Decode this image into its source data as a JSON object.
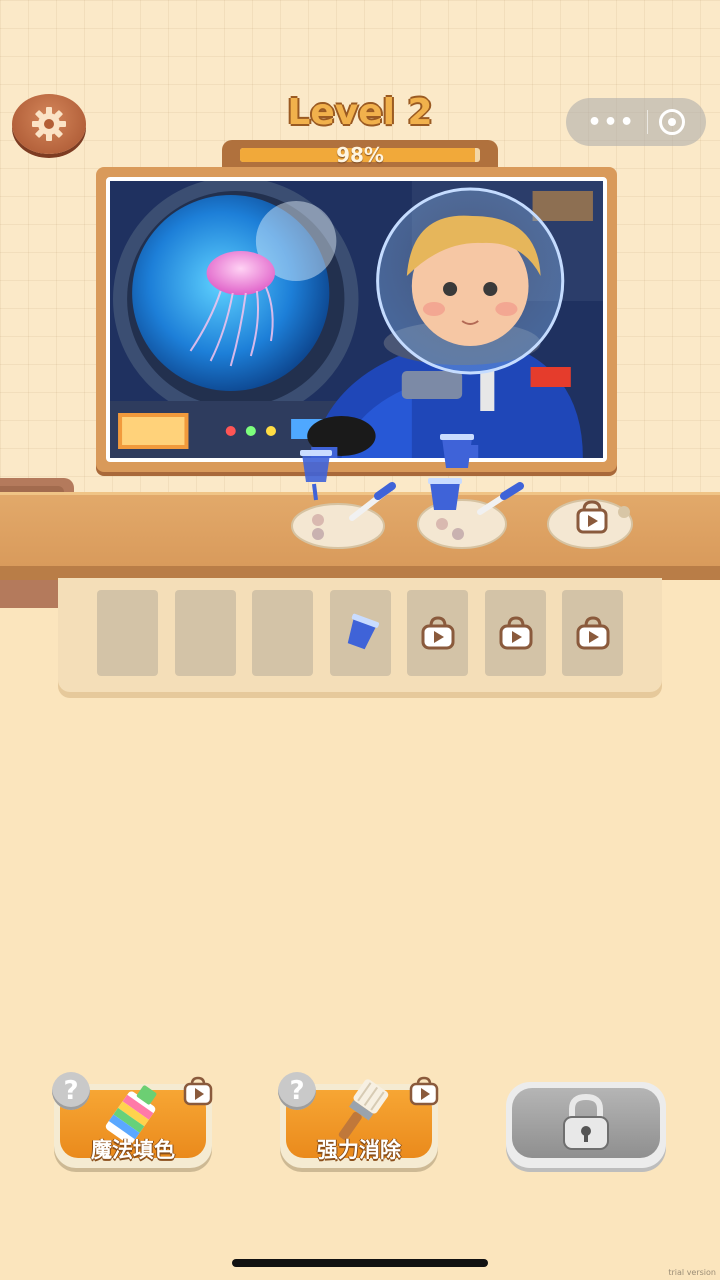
{
  "header": {
    "level_title": "Level 2",
    "progress_text": "98%",
    "progress_fraction": 0.98
  },
  "capsule": {
    "more_icon": "more-dots-icon",
    "close_icon": "target-circle-icon"
  },
  "painting": {
    "subject": "astronaut-boy-jellyfish-porthole"
  },
  "shelf": {
    "palettes": [
      {
        "state": "cup-and-brush"
      },
      {
        "state": "cup-and-brush"
      },
      {
        "state": "locked-video"
      }
    ]
  },
  "slots": [
    {
      "state": "empty"
    },
    {
      "state": "empty"
    },
    {
      "state": "empty"
    },
    {
      "state": "cup"
    },
    {
      "state": "locked-video"
    },
    {
      "state": "locked-video"
    },
    {
      "state": "locked-video"
    }
  ],
  "tools": {
    "magic_fill_label": "魔法填色",
    "power_remove_label": "强力消除",
    "help_glyph": "?"
  },
  "footer": {
    "version_text": "trial version"
  },
  "colors": {
    "accent_orange": "#f1a93a",
    "cup_blue": "#3f63d8",
    "background": "#fbe5bd"
  }
}
